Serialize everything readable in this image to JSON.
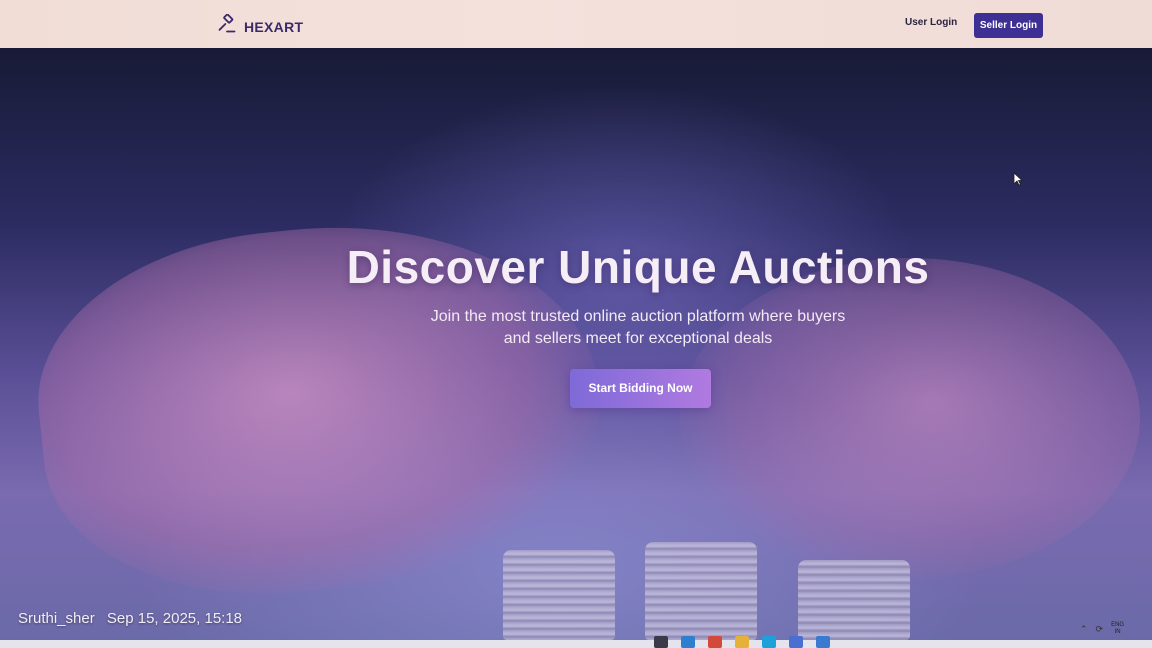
{
  "header": {
    "logo_text": "HEXART",
    "logo_icon": "gavel-icon",
    "user_login": "User Login",
    "seller_login": "Seller Login"
  },
  "hero": {
    "title": "Discover Unique Auctions",
    "subtitle_line1": "Join the most trusted online auction platform where buyers",
    "subtitle_line2": "and sellers meet for exceptional deals",
    "cta_label": "Start Bidding Now"
  },
  "overlay": {
    "username": "Sruthi_sher",
    "timestamp": "Sep 15, 2025, 15:18"
  },
  "taskbar": {
    "lang_line1": "ENG",
    "lang_line2": "IN"
  },
  "colors": {
    "brand": "#3a2a6a",
    "seller_button": "#3d2f93",
    "cta_start": "#7e6ad8",
    "cta_end": "#b07ae0"
  }
}
